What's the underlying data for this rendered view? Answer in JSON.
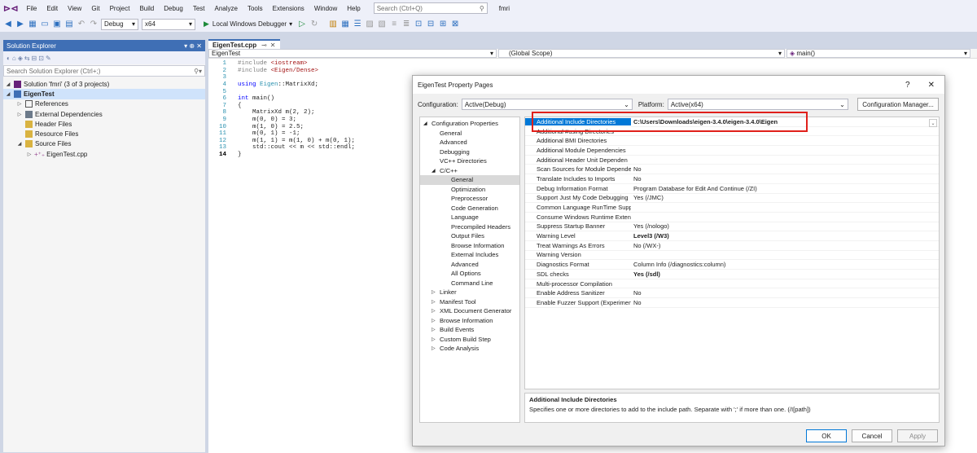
{
  "menubar": {
    "items": [
      "File",
      "Edit",
      "View",
      "Git",
      "Project",
      "Build",
      "Debug",
      "Test",
      "Analyze",
      "Tools",
      "Extensions",
      "Window",
      "Help"
    ],
    "search_placeholder": "Search (Ctrl+Q)",
    "project_name": "fmri"
  },
  "toolbar": {
    "config": "Debug",
    "platform": "x64",
    "debugger_label": "Local Windows Debugger"
  },
  "solution_explorer": {
    "title": "Solution Explorer",
    "search_placeholder": "Search Solution Explorer (Ctrl+;)",
    "items": [
      {
        "label": "Solution 'fmri' (3 of 3 projects)"
      },
      {
        "label": "EigenTest"
      },
      {
        "label": "References"
      },
      {
        "label": "External Dependencies"
      },
      {
        "label": "Header Files"
      },
      {
        "label": "Resource Files"
      },
      {
        "label": "Source Files"
      },
      {
        "label": "EigenTest.cpp"
      }
    ]
  },
  "editor": {
    "tab_label": "EigenTest.cpp",
    "nav_project": "EigenTest",
    "nav_scope": "(Global Scope)",
    "nav_member": "main()",
    "lines": [
      {
        "n": "1",
        "segs": [
          {
            "c": "pp",
            "t": "#include "
          },
          {
            "c": "str",
            "t": "<iostream>"
          }
        ]
      },
      {
        "n": "2",
        "segs": [
          {
            "c": "pp",
            "t": "#include "
          },
          {
            "c": "str",
            "t": "<Eigen/Dense>"
          }
        ]
      },
      {
        "n": "3",
        "segs": []
      },
      {
        "n": "4",
        "segs": [
          {
            "c": "kw",
            "t": "using "
          },
          {
            "c": "typ",
            "t": "Eigen"
          },
          {
            "c": "",
            "t": "::MatrixXd;"
          }
        ]
      },
      {
        "n": "5",
        "segs": []
      },
      {
        "n": "6",
        "segs": [
          {
            "c": "kw",
            "t": "int "
          },
          {
            "c": "",
            "t": "main()"
          }
        ]
      },
      {
        "n": "7",
        "segs": [
          {
            "c": "",
            "t": "{"
          }
        ]
      },
      {
        "n": "8",
        "segs": [
          {
            "c": "",
            "t": "    MatrixXd m(2, 2);"
          }
        ]
      },
      {
        "n": "9",
        "segs": [
          {
            "c": "",
            "t": "    m(0, 0) = 3;"
          }
        ]
      },
      {
        "n": "10",
        "segs": [
          {
            "c": "",
            "t": "    m(1, 0) = 2.5;"
          }
        ]
      },
      {
        "n": "11",
        "segs": [
          {
            "c": "",
            "t": "    m(0, 1) = -1;"
          }
        ]
      },
      {
        "n": "12",
        "segs": [
          {
            "c": "",
            "t": "    m(1, 1) = m(1, 0) + m(0, 1);"
          }
        ]
      },
      {
        "n": "13",
        "segs": [
          {
            "c": "",
            "t": "    std::cout << m << std::endl;"
          }
        ]
      },
      {
        "n": "14",
        "segs": [
          {
            "c": "",
            "t": "}"
          }
        ]
      }
    ]
  },
  "dialog": {
    "title": "EigenTest Property Pages",
    "help": "?",
    "close": "✕",
    "configuration_label": "Configuration:",
    "configuration_value": "Active(Debug)",
    "platform_label": "Platform:",
    "platform_value": "Active(x64)",
    "config_manager": "Configuration Manager...",
    "categories": [
      {
        "label": "Configuration Properties",
        "lvl": 0,
        "tri": "◢"
      },
      {
        "label": "General",
        "lvl": 1,
        "tri": ""
      },
      {
        "label": "Advanced",
        "lvl": 1,
        "tri": ""
      },
      {
        "label": "Debugging",
        "lvl": 1,
        "tri": ""
      },
      {
        "label": "VC++ Directories",
        "lvl": 1,
        "tri": ""
      },
      {
        "label": "C/C++",
        "lvl": 1,
        "tri": "◢"
      },
      {
        "label": "General",
        "lvl": 2,
        "tri": "",
        "sel": true
      },
      {
        "label": "Optimization",
        "lvl": 2,
        "tri": ""
      },
      {
        "label": "Preprocessor",
        "lvl": 2,
        "tri": ""
      },
      {
        "label": "Code Generation",
        "lvl": 2,
        "tri": ""
      },
      {
        "label": "Language",
        "lvl": 2,
        "tri": ""
      },
      {
        "label": "Precompiled Headers",
        "lvl": 2,
        "tri": ""
      },
      {
        "label": "Output Files",
        "lvl": 2,
        "tri": ""
      },
      {
        "label": "Browse Information",
        "lvl": 2,
        "tri": ""
      },
      {
        "label": "External Includes",
        "lvl": 2,
        "tri": ""
      },
      {
        "label": "Advanced",
        "lvl": 2,
        "tri": ""
      },
      {
        "label": "All Options",
        "lvl": 2,
        "tri": ""
      },
      {
        "label": "Command Line",
        "lvl": 2,
        "tri": ""
      },
      {
        "label": "Linker",
        "lvl": 1,
        "tri": "▷"
      },
      {
        "label": "Manifest Tool",
        "lvl": 1,
        "tri": "▷"
      },
      {
        "label": "XML Document Generator",
        "lvl": 1,
        "tri": "▷"
      },
      {
        "label": "Browse Information",
        "lvl": 1,
        "tri": "▷"
      },
      {
        "label": "Build Events",
        "lvl": 1,
        "tri": "▷"
      },
      {
        "label": "Custom Build Step",
        "lvl": 1,
        "tri": "▷"
      },
      {
        "label": "Code Analysis",
        "lvl": 1,
        "tri": "▷"
      }
    ],
    "properties": [
      {
        "k": "Additional Include Directories",
        "v": "C:\\Users\\Downloads\\eigen-3.4.0\\eigen-3.4.0\\Eigen",
        "sel": true
      },
      {
        "k": "Additional #using Directories",
        "v": ""
      },
      {
        "k": "Additional BMI Directories",
        "v": ""
      },
      {
        "k": "Additional Module Dependencies",
        "v": ""
      },
      {
        "k": "Additional Header Unit Dependen",
        "v": ""
      },
      {
        "k": "Scan Sources for Module Depende",
        "v": "No"
      },
      {
        "k": "Translate Includes to Imports",
        "v": "No"
      },
      {
        "k": "Debug Information Format",
        "v": "Program Database for Edit And Continue (/ZI)"
      },
      {
        "k": "Support Just My Code Debugging",
        "v": "Yes (/JMC)"
      },
      {
        "k": "Common Language RunTime Supp",
        "v": ""
      },
      {
        "k": "Consume Windows Runtime Exten",
        "v": ""
      },
      {
        "k": "Suppress Startup Banner",
        "v": "Yes (/nologo)"
      },
      {
        "k": "Warning Level",
        "v": "Level3 (/W3)",
        "bold": true
      },
      {
        "k": "Treat Warnings As Errors",
        "v": "No (/WX-)"
      },
      {
        "k": "Warning Version",
        "v": ""
      },
      {
        "k": "Diagnostics Format",
        "v": "Column Info (/diagnostics:column)"
      },
      {
        "k": "SDL checks",
        "v": "Yes (/sdl)",
        "bold": true
      },
      {
        "k": "Multi-processor Compilation",
        "v": ""
      },
      {
        "k": "Enable Address Sanitizer",
        "v": "No"
      },
      {
        "k": "Enable Fuzzer Support (Experimen",
        "v": "No"
      }
    ],
    "desc_title": "Additional Include Directories",
    "desc_text": "Specifies one or more directories to add to the include path. Separate with ';' if more than one.     (/I[path])",
    "ok": "OK",
    "cancel": "Cancel",
    "apply": "Apply"
  }
}
